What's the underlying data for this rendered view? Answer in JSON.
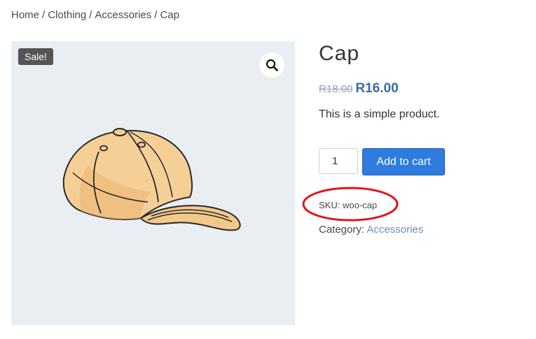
{
  "breadcrumb": {
    "items": [
      "Home",
      "Clothing",
      "Accessories",
      "Cap"
    ],
    "separator": "/"
  },
  "gallery": {
    "sale_badge": "Sale!",
    "zoom_icon": "magnifier-icon",
    "image": "baseball-cap-illustration"
  },
  "product": {
    "title": "Cap",
    "price_old": "R18.00",
    "price_new": "R16.00",
    "description": "This is a simple product.",
    "quantity": "1",
    "add_to_cart_label": "Add to cart",
    "sku_label": "SKU:",
    "sku_value": "woo-cap",
    "category_label": "Category:",
    "category_link": "Accessories"
  },
  "annotation": {
    "shape": "ellipse",
    "color": "#e0141b"
  },
  "colors": {
    "price_new": "#3c6aa3",
    "price_old": "#8ea3bd",
    "button": "#2e7ce0",
    "badge": "#555555",
    "gallery_bg": "#e9eef2"
  }
}
